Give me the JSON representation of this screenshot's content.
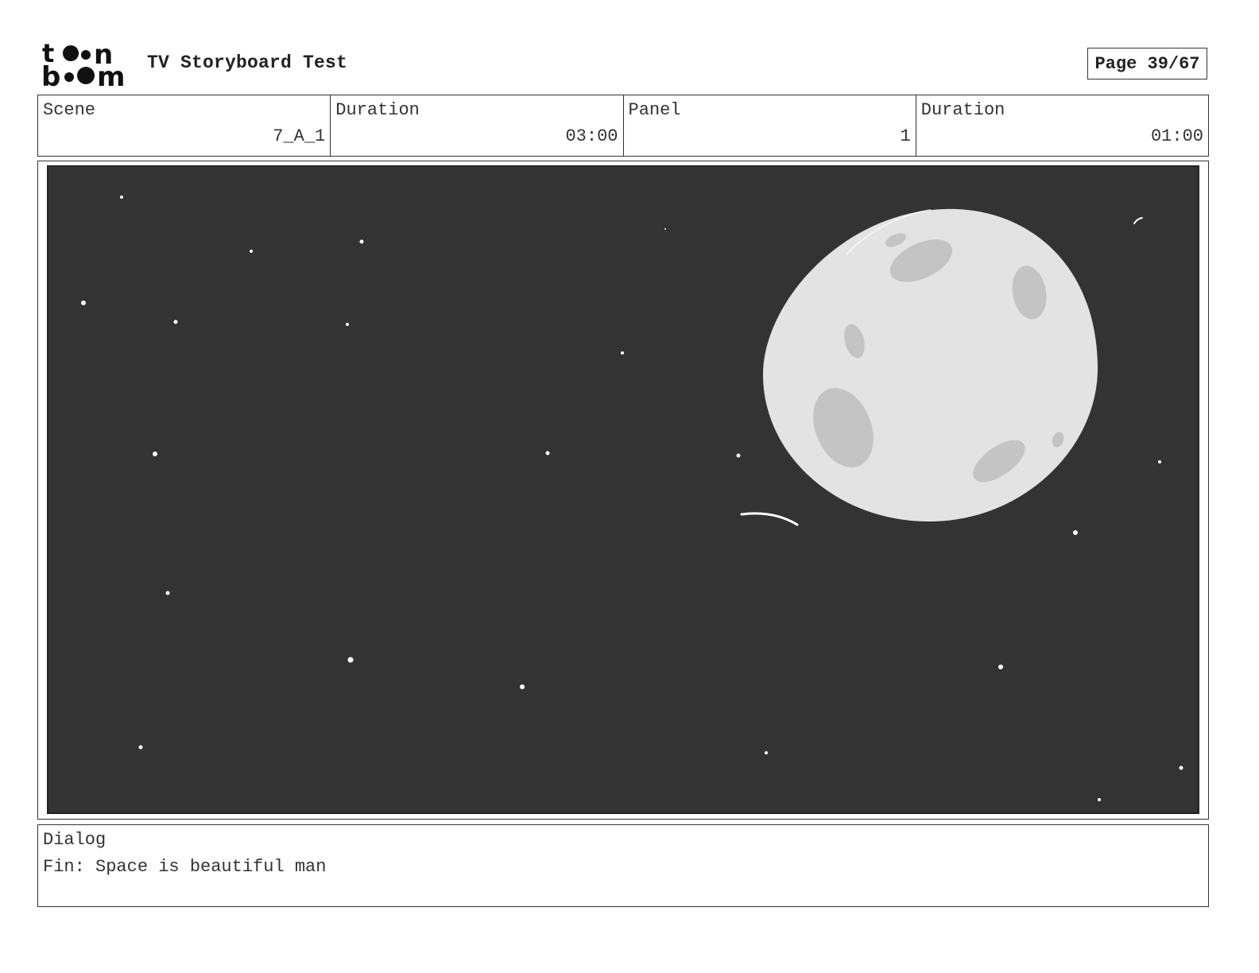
{
  "header": {
    "logo_text": "toon boom",
    "title": "TV Storyboard Test",
    "page_label": "Page 39/67"
  },
  "info": {
    "scene_label": "Scene",
    "scene_value": "7_A_1",
    "scene_duration_label": "Duration",
    "scene_duration_value": "03:00",
    "panel_label": "Panel",
    "panel_value": "1",
    "panel_duration_label": "Duration",
    "panel_duration_value": "01:00"
  },
  "panel": {
    "background_color": "#333333",
    "moon_color": "#e3e3e3",
    "crater_color": "#c4c4c4",
    "star_color": "#ffffff"
  },
  "dialog": {
    "label": "Dialog",
    "text": "Fin: Space is beautiful man"
  }
}
